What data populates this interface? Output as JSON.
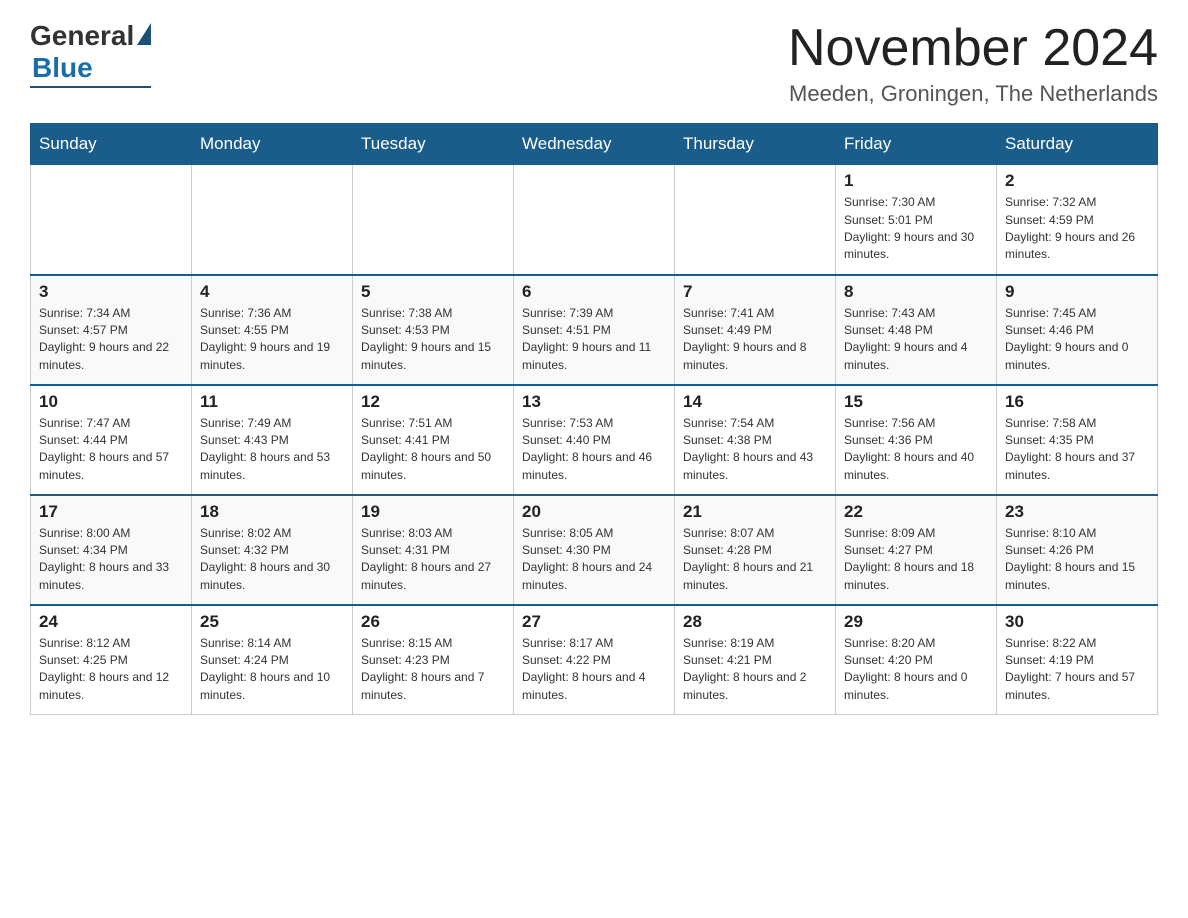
{
  "header": {
    "logo_general": "General",
    "logo_blue": "Blue",
    "month_title": "November 2024",
    "location": "Meeden, Groningen, The Netherlands"
  },
  "days_of_week": [
    "Sunday",
    "Monday",
    "Tuesday",
    "Wednesday",
    "Thursday",
    "Friday",
    "Saturday"
  ],
  "weeks": [
    [
      {
        "day": "",
        "sunrise": "",
        "sunset": "",
        "daylight": ""
      },
      {
        "day": "",
        "sunrise": "",
        "sunset": "",
        "daylight": ""
      },
      {
        "day": "",
        "sunrise": "",
        "sunset": "",
        "daylight": ""
      },
      {
        "day": "",
        "sunrise": "",
        "sunset": "",
        "daylight": ""
      },
      {
        "day": "",
        "sunrise": "",
        "sunset": "",
        "daylight": ""
      },
      {
        "day": "1",
        "sunrise": "Sunrise: 7:30 AM",
        "sunset": "Sunset: 5:01 PM",
        "daylight": "Daylight: 9 hours and 30 minutes."
      },
      {
        "day": "2",
        "sunrise": "Sunrise: 7:32 AM",
        "sunset": "Sunset: 4:59 PM",
        "daylight": "Daylight: 9 hours and 26 minutes."
      }
    ],
    [
      {
        "day": "3",
        "sunrise": "Sunrise: 7:34 AM",
        "sunset": "Sunset: 4:57 PM",
        "daylight": "Daylight: 9 hours and 22 minutes."
      },
      {
        "day": "4",
        "sunrise": "Sunrise: 7:36 AM",
        "sunset": "Sunset: 4:55 PM",
        "daylight": "Daylight: 9 hours and 19 minutes."
      },
      {
        "day": "5",
        "sunrise": "Sunrise: 7:38 AM",
        "sunset": "Sunset: 4:53 PM",
        "daylight": "Daylight: 9 hours and 15 minutes."
      },
      {
        "day": "6",
        "sunrise": "Sunrise: 7:39 AM",
        "sunset": "Sunset: 4:51 PM",
        "daylight": "Daylight: 9 hours and 11 minutes."
      },
      {
        "day": "7",
        "sunrise": "Sunrise: 7:41 AM",
        "sunset": "Sunset: 4:49 PM",
        "daylight": "Daylight: 9 hours and 8 minutes."
      },
      {
        "day": "8",
        "sunrise": "Sunrise: 7:43 AM",
        "sunset": "Sunset: 4:48 PM",
        "daylight": "Daylight: 9 hours and 4 minutes."
      },
      {
        "day": "9",
        "sunrise": "Sunrise: 7:45 AM",
        "sunset": "Sunset: 4:46 PM",
        "daylight": "Daylight: 9 hours and 0 minutes."
      }
    ],
    [
      {
        "day": "10",
        "sunrise": "Sunrise: 7:47 AM",
        "sunset": "Sunset: 4:44 PM",
        "daylight": "Daylight: 8 hours and 57 minutes."
      },
      {
        "day": "11",
        "sunrise": "Sunrise: 7:49 AM",
        "sunset": "Sunset: 4:43 PM",
        "daylight": "Daylight: 8 hours and 53 minutes."
      },
      {
        "day": "12",
        "sunrise": "Sunrise: 7:51 AM",
        "sunset": "Sunset: 4:41 PM",
        "daylight": "Daylight: 8 hours and 50 minutes."
      },
      {
        "day": "13",
        "sunrise": "Sunrise: 7:53 AM",
        "sunset": "Sunset: 4:40 PM",
        "daylight": "Daylight: 8 hours and 46 minutes."
      },
      {
        "day": "14",
        "sunrise": "Sunrise: 7:54 AM",
        "sunset": "Sunset: 4:38 PM",
        "daylight": "Daylight: 8 hours and 43 minutes."
      },
      {
        "day": "15",
        "sunrise": "Sunrise: 7:56 AM",
        "sunset": "Sunset: 4:36 PM",
        "daylight": "Daylight: 8 hours and 40 minutes."
      },
      {
        "day": "16",
        "sunrise": "Sunrise: 7:58 AM",
        "sunset": "Sunset: 4:35 PM",
        "daylight": "Daylight: 8 hours and 37 minutes."
      }
    ],
    [
      {
        "day": "17",
        "sunrise": "Sunrise: 8:00 AM",
        "sunset": "Sunset: 4:34 PM",
        "daylight": "Daylight: 8 hours and 33 minutes."
      },
      {
        "day": "18",
        "sunrise": "Sunrise: 8:02 AM",
        "sunset": "Sunset: 4:32 PM",
        "daylight": "Daylight: 8 hours and 30 minutes."
      },
      {
        "day": "19",
        "sunrise": "Sunrise: 8:03 AM",
        "sunset": "Sunset: 4:31 PM",
        "daylight": "Daylight: 8 hours and 27 minutes."
      },
      {
        "day": "20",
        "sunrise": "Sunrise: 8:05 AM",
        "sunset": "Sunset: 4:30 PM",
        "daylight": "Daylight: 8 hours and 24 minutes."
      },
      {
        "day": "21",
        "sunrise": "Sunrise: 8:07 AM",
        "sunset": "Sunset: 4:28 PM",
        "daylight": "Daylight: 8 hours and 21 minutes."
      },
      {
        "day": "22",
        "sunrise": "Sunrise: 8:09 AM",
        "sunset": "Sunset: 4:27 PM",
        "daylight": "Daylight: 8 hours and 18 minutes."
      },
      {
        "day": "23",
        "sunrise": "Sunrise: 8:10 AM",
        "sunset": "Sunset: 4:26 PM",
        "daylight": "Daylight: 8 hours and 15 minutes."
      }
    ],
    [
      {
        "day": "24",
        "sunrise": "Sunrise: 8:12 AM",
        "sunset": "Sunset: 4:25 PM",
        "daylight": "Daylight: 8 hours and 12 minutes."
      },
      {
        "day": "25",
        "sunrise": "Sunrise: 8:14 AM",
        "sunset": "Sunset: 4:24 PM",
        "daylight": "Daylight: 8 hours and 10 minutes."
      },
      {
        "day": "26",
        "sunrise": "Sunrise: 8:15 AM",
        "sunset": "Sunset: 4:23 PM",
        "daylight": "Daylight: 8 hours and 7 minutes."
      },
      {
        "day": "27",
        "sunrise": "Sunrise: 8:17 AM",
        "sunset": "Sunset: 4:22 PM",
        "daylight": "Daylight: 8 hours and 4 minutes."
      },
      {
        "day": "28",
        "sunrise": "Sunrise: 8:19 AM",
        "sunset": "Sunset: 4:21 PM",
        "daylight": "Daylight: 8 hours and 2 minutes."
      },
      {
        "day": "29",
        "sunrise": "Sunrise: 8:20 AM",
        "sunset": "Sunset: 4:20 PM",
        "daylight": "Daylight: 8 hours and 0 minutes."
      },
      {
        "day": "30",
        "sunrise": "Sunrise: 8:22 AM",
        "sunset": "Sunset: 4:19 PM",
        "daylight": "Daylight: 7 hours and 57 minutes."
      }
    ]
  ]
}
